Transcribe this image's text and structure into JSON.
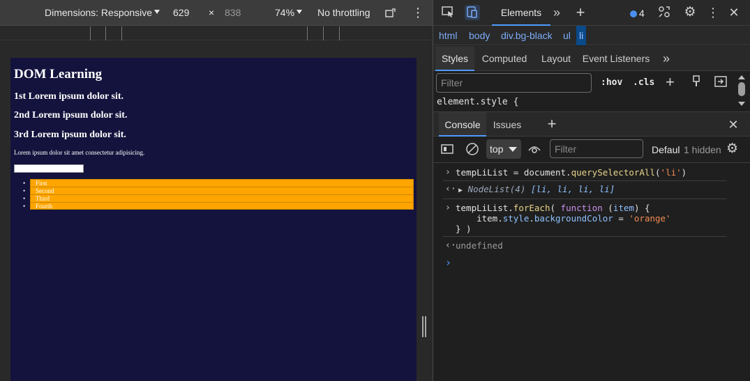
{
  "device_toolbar": {
    "dimensions_label": "Dimensions: Responsive",
    "width": "629",
    "times": "×",
    "height": "838",
    "zoom": "74%",
    "throttling": "No throttling"
  },
  "page": {
    "title": "DOM Learning",
    "headings": [
      "1st Lorem ipsum dolor sit.",
      "2nd Lorem ipsum dolor sit.",
      "3rd Lorem ipsum dolor sit."
    ],
    "paragraph": "Lorem ipsum dolor sit amet consectetur adipisicing.",
    "list_items": [
      "First",
      "Second",
      "Third",
      "Fourth"
    ],
    "bg_color": "#14133d",
    "li_color": "#ffa500"
  },
  "devtools": {
    "panel_tab": "Elements",
    "issues_count": "4",
    "breadcrumb": [
      "html",
      "body",
      "div.bg-black",
      "ul",
      "li"
    ],
    "styles_tabs": [
      "Styles",
      "Computed",
      "Layout",
      "Event Listeners"
    ],
    "filter_placeholder": "Filter",
    "hov_label": ":hov",
    "cls_label": ".cls",
    "element_style": "element.style {",
    "console_tabs": [
      "Console",
      "Issues"
    ],
    "context": "top",
    "console_filter_placeholder": "Filter",
    "levels": "Defaul",
    "hidden": "1 hidden",
    "console": {
      "line1_var": "tempLiList",
      "line1_eq": " = document.",
      "line1_fn": "querySelectorAll",
      "line1_open": "(",
      "line1_str": "'li'",
      "line1_close": ")",
      "out1_type": "NodeList(4)",
      "out1_items": "[li, li, li, li]",
      "line2_a": "tempLiList.",
      "line2_fn": "forEach",
      "line2_b": "( ",
      "line2_kw": "function",
      "line2_c": " (",
      "line2_param": "item",
      "line2_d": ") {",
      "line3_a": "    item.",
      "line3_prop1": "style",
      "line3_b": ".",
      "line3_prop2": "backgroundColor",
      "line3_c": " = ",
      "line3_str": "'orange'",
      "line4": "} )",
      "out2": "undefined"
    }
  }
}
